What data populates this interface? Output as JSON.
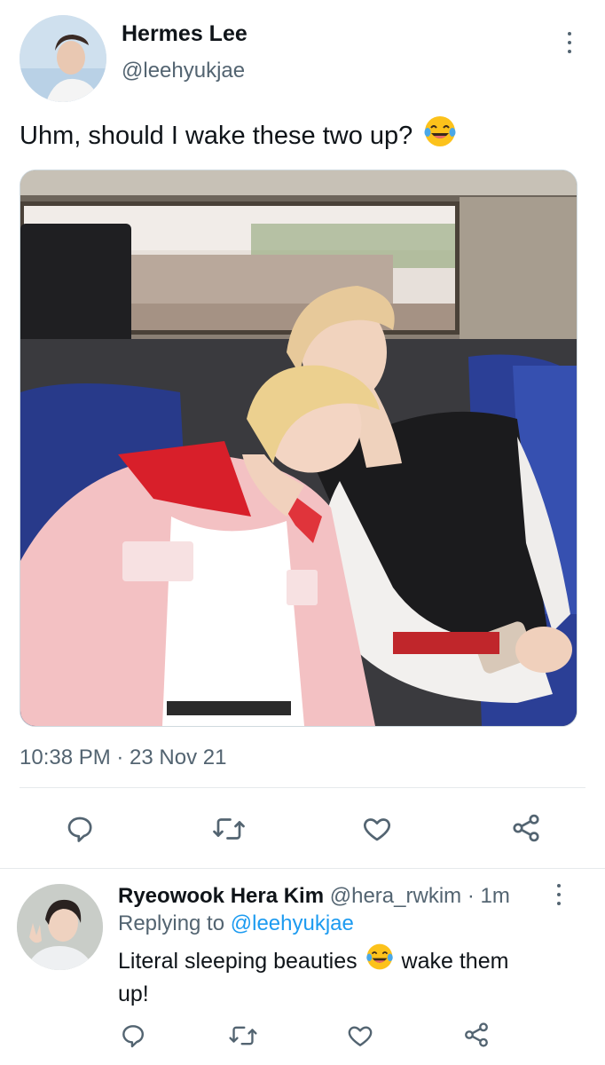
{
  "tweet": {
    "author_name": "Hermes Lee",
    "author_handle": "@leehyukjae",
    "text": "Uhm, should I wake these two up?",
    "emoji": "face-with-tears-of-joy",
    "timestamp": "10:38 PM · 23 Nov 21"
  },
  "actions": [
    "reply-icon",
    "retweet-icon",
    "like-icon",
    "share-icon"
  ],
  "reply": {
    "author_name": "Ryeowook Hera Kim",
    "author_handle": "@hera_rwkim",
    "time": "· 1m",
    "replying_prefix": "Replying to",
    "replying_to": "@leehyukjae",
    "text_before": "Literal sleeping beauties",
    "emoji": "face-with-tears-of-joy",
    "text_after_line1": "wake them",
    "text_after_line2": "up!"
  },
  "colors": {
    "accent": "#1d9bf0",
    "secondary_text": "#536471",
    "divider": "#e6e9ec"
  }
}
